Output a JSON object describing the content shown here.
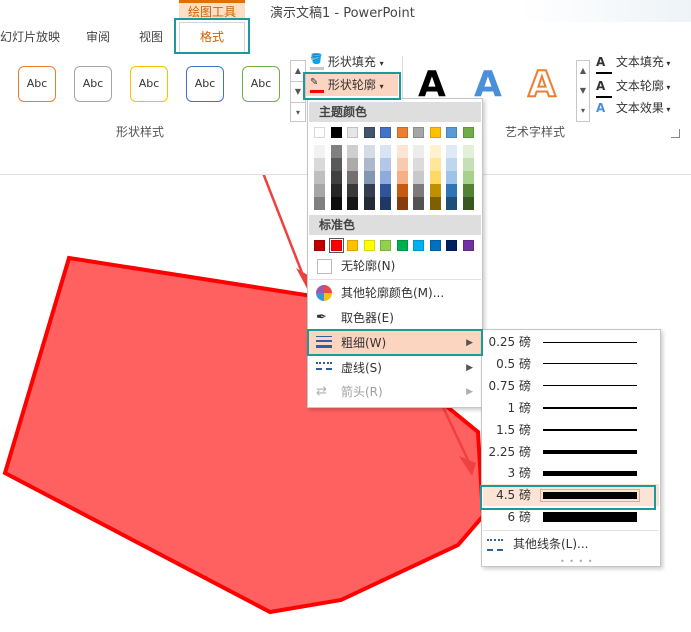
{
  "title_bar": {
    "tool_label": "绘图工具",
    "doc_title": "演示文稿1 - PowerPoint"
  },
  "tabs": [
    {
      "label": "幻灯片放映"
    },
    {
      "label": "审阅"
    },
    {
      "label": "视图"
    },
    {
      "label": "格式",
      "active": true
    }
  ],
  "shape_styles": {
    "group_label": "形状样式",
    "thumbnails": [
      {
        "text": "Abc",
        "color": "#ed7d31"
      },
      {
        "text": "Abc",
        "color": "#a5a5a5"
      },
      {
        "text": "Abc",
        "color": "#ffc000"
      },
      {
        "text": "Abc",
        "color": "#4472c4"
      },
      {
        "text": "Abc",
        "color": "#70ad47"
      }
    ]
  },
  "shape_commands": {
    "fill": "形状填充",
    "outline": "形状轮廓"
  },
  "wordart": {
    "group_label": "艺术字样式",
    "letters": [
      "A",
      "A",
      "A"
    ],
    "commands": {
      "text_fill": "文本填充",
      "text_outline": "文本轮廓",
      "text_effect": "文本效果"
    }
  },
  "outline_menu": {
    "theme_colors_label": "主题颜色",
    "theme_colors": [
      [
        "#ffffff",
        "#f2f2f2",
        "#d9d9d9",
        "#bfbfbf",
        "#a6a6a6",
        "#808080"
      ],
      [
        "#000000",
        "#808080",
        "#595959",
        "#404040",
        "#262626",
        "#0d0d0d"
      ],
      [
        "#e7e6e6",
        "#d0cece",
        "#aeaaaa",
        "#757070",
        "#3a3838",
        "#171616"
      ],
      [
        "#44546a",
        "#d6dce5",
        "#adb9ca",
        "#8497b0",
        "#333f50",
        "#222a35"
      ],
      [
        "#4472c4",
        "#dae3f3",
        "#b4c7e7",
        "#8faadc",
        "#2f5597",
        "#203864"
      ],
      [
        "#ed7d31",
        "#fbe5d6",
        "#f8cbad",
        "#f4b183",
        "#c55a11",
        "#843c0c"
      ],
      [
        "#a5a5a5",
        "#ededed",
        "#dbdbdb",
        "#c9c9c9",
        "#7b7b7b",
        "#525252"
      ],
      [
        "#ffc000",
        "#fff2cc",
        "#ffe699",
        "#ffd966",
        "#bf9000",
        "#7f6000"
      ],
      [
        "#5b9bd5",
        "#deebf7",
        "#bdd7ee",
        "#9dc3e6",
        "#2e75b6",
        "#1f4e79"
      ],
      [
        "#70ad47",
        "#e2f0d9",
        "#c5e0b4",
        "#a9d18e",
        "#548235",
        "#385723"
      ]
    ],
    "standard_colors_label": "标准色",
    "standard_colors": [
      "#c00000",
      "#ff0000",
      "#ffc000",
      "#ffff00",
      "#92d050",
      "#00b050",
      "#00b0f0",
      "#0070c0",
      "#002060",
      "#7030a0"
    ],
    "items": {
      "no_outline": "无轮廓(N)",
      "more_colors": "其他轮廓颜色(M)...",
      "eyedropper": "取色器(E)",
      "weight": "粗细(W)",
      "dashes": "虚线(S)",
      "arrows": "箭头(R)"
    }
  },
  "weight_submenu": {
    "options": [
      {
        "label": "0.25 磅",
        "points": 0.25
      },
      {
        "label": "0.5 磅",
        "points": 0.5
      },
      {
        "label": "0.75 磅",
        "points": 0.75
      },
      {
        "label": "1 磅",
        "points": 1
      },
      {
        "label": "1.5 磅",
        "points": 1.5
      },
      {
        "label": "2.25 磅",
        "points": 2.25
      },
      {
        "label": "3 磅",
        "points": 3
      },
      {
        "label": "4.5 磅",
        "points": 4.5,
        "selected": true
      },
      {
        "label": "6 磅",
        "points": 6
      }
    ],
    "more_lines": "其他线条(L)..."
  },
  "shape": {
    "fill": "#ff6060",
    "outline": "#ff0000"
  },
  "colors": {
    "accent_teal": "#1a9a9a",
    "annotation_red": "#f04040",
    "tool_orange": "#e07000"
  }
}
